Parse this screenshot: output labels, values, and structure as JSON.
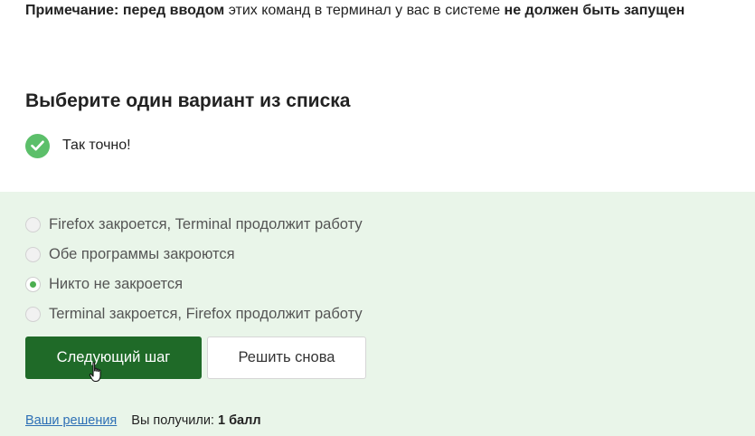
{
  "note": {
    "label": "Примечание:",
    "bold1": "перед вводом",
    "text": "этих команд в терминал у вас в системе",
    "bold2": "не должен быть запущен"
  },
  "question": {
    "title": "Выберите один вариант из списка"
  },
  "feedback": {
    "icon": "check-circle-icon",
    "color": "#5cbf6a",
    "text": "Так точно!"
  },
  "options": [
    {
      "label": "Firefox закроется, Terminal продолжит работу",
      "selected": false
    },
    {
      "label": "Обе программы закроются",
      "selected": false
    },
    {
      "label": "Никто не закроется",
      "selected": true
    },
    {
      "label": "Terminal закроется, Firefox продолжит работу",
      "selected": false
    }
  ],
  "buttons": {
    "next_label": "Следующий шаг",
    "retry_label": "Решить снова"
  },
  "footer": {
    "solutions_link": "Ваши решения",
    "score_prefix": "Вы получили:",
    "score_value": "1 балл"
  },
  "colors": {
    "accent": "#1f6a28",
    "panel_bg": "#e9f5e9",
    "link": "#2d6fb5"
  }
}
